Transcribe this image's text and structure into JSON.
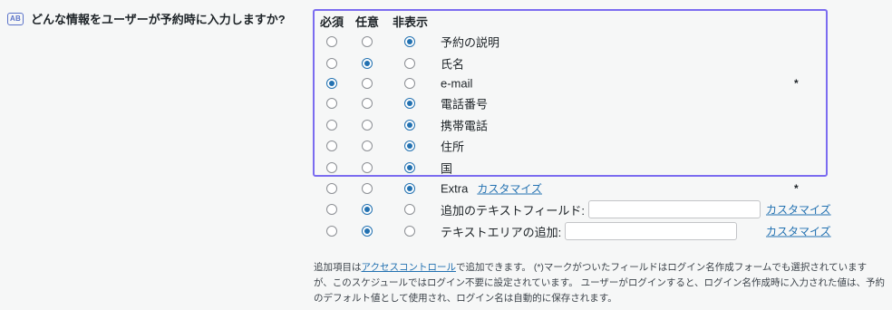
{
  "question": {
    "icon": "ab-icon",
    "icon_text": "AB",
    "label": "どんな情報をユーザーが予約時に入力しますか?"
  },
  "headers": [
    "必須",
    "任意",
    "非表示"
  ],
  "rows": [
    {
      "label": "予約の説明",
      "selection": "非表示"
    },
    {
      "label": "氏名",
      "selection": "任意"
    },
    {
      "label": "e-mail",
      "selection": "必須",
      "star": "*"
    },
    {
      "label": "電話番号",
      "selection": "非表示"
    },
    {
      "label": "携帯電話",
      "selection": "非表示"
    },
    {
      "label": "住所",
      "selection": "非表示"
    },
    {
      "label": "国",
      "selection": "非表示"
    },
    {
      "label": "Extra",
      "selection": "非表示",
      "link": "カスタマイズ",
      "star": "*"
    },
    {
      "label": "追加のテキストフィールド:",
      "selection": "任意",
      "input_value": "",
      "right_link": "カスタマイズ"
    },
    {
      "label": "テキストエリアの追加:",
      "selection": "任意",
      "input_value": "",
      "right_link": "カスタマイズ"
    }
  ],
  "note": {
    "pre": "追加項目は",
    "link": "アクセスコントロール",
    "post": "で追加できます。 (*)マークがついたフィールドはログイン名作成フォームでも選択されていますが、このスケジュールではログイン不要に設定されています。 ユーザーがログインすると、ログイン名作成時に入力された値は、予約のデフォルト値として使用され、ログイン名は自動的に保存されます。"
  },
  "colors": {
    "accent": "#2271b1",
    "highlight_border": "#7b6cf0",
    "background": "#f6f7f7"
  }
}
